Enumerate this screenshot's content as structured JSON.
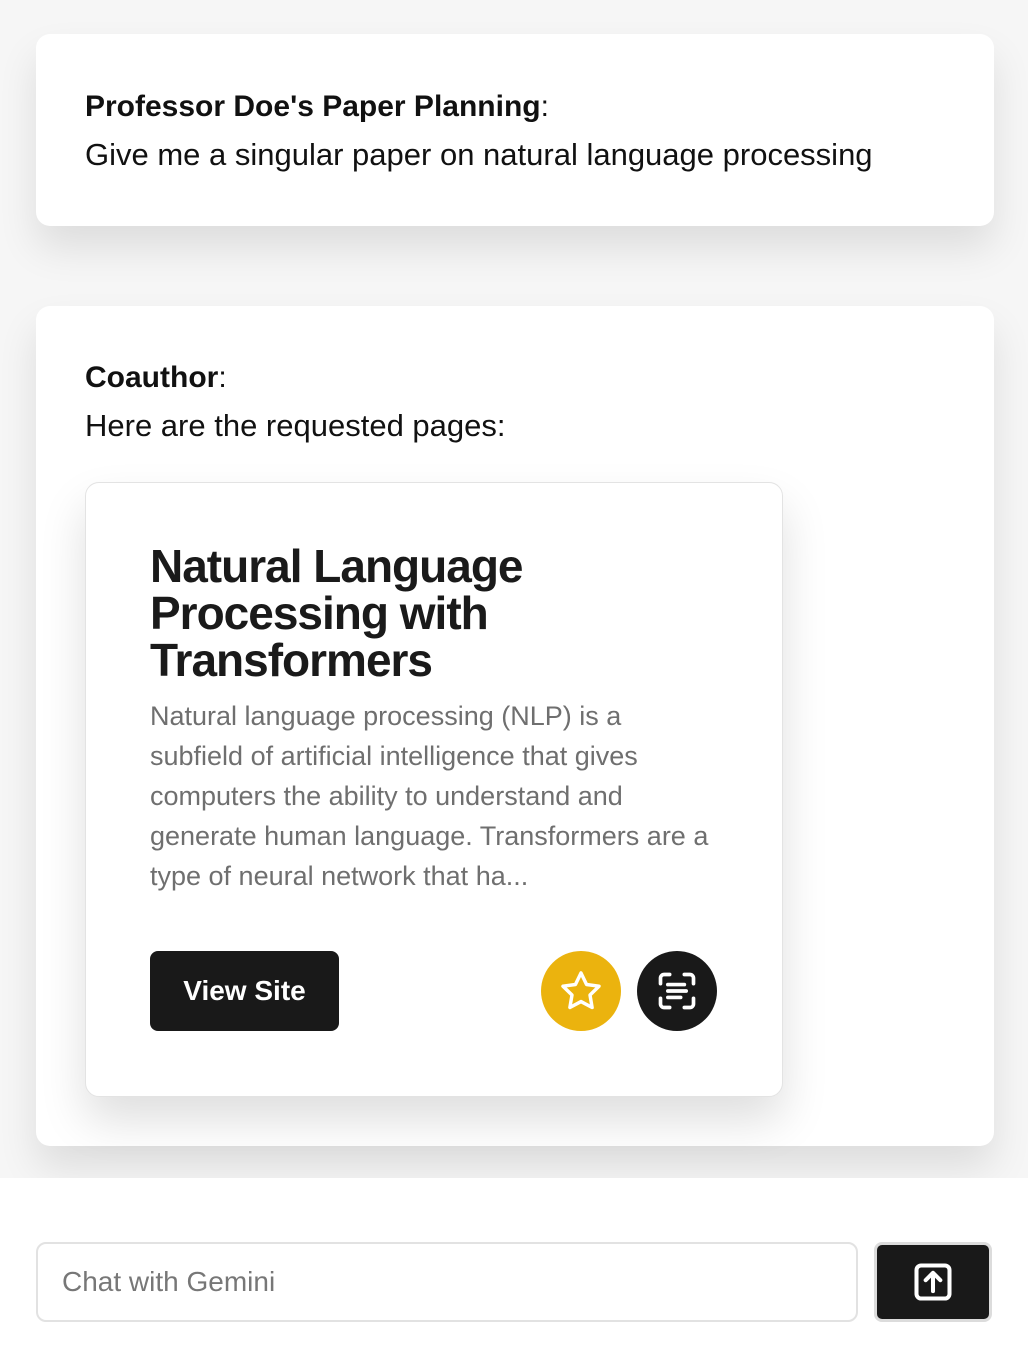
{
  "messages": [
    {
      "sender": "Professor Doe's Paper Planning",
      "separator": ":",
      "text": "Give me a singular paper on natural language processing"
    },
    {
      "sender": "Coauthor",
      "separator": ":",
      "text": "Here are the requested pages:"
    }
  ],
  "paper_card": {
    "title": "Natural Language Processing with Transformers",
    "abstract": "Natural language processing (NLP) is a subfield of artificial intelligence that gives computers the ability to understand and generate human language. Transformers are a type of neural network that ha...",
    "view_button_label": "View Site",
    "favorite_icon": "star-icon",
    "summary_icon": "scan-text-icon"
  },
  "composer": {
    "placeholder": "Chat with Gemini",
    "value": "",
    "send_icon": "upload-arrow-icon"
  },
  "colors": {
    "favorite_button": "#ebb30e",
    "dark_button": "#191919",
    "page_background": "#f6f6f6"
  }
}
